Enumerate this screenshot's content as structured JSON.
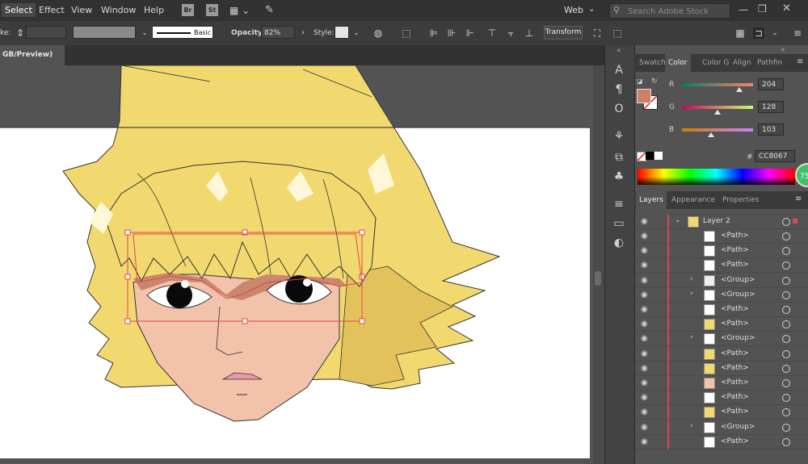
{
  "menu": {
    "items": [
      "Select",
      "Effect",
      "View",
      "Window",
      "Help"
    ],
    "workspace": "Web",
    "search_placeholder": "Search Adobe Stock",
    "bridge": "Br",
    "stock": "St"
  },
  "control": {
    "stroke_label": "ke:",
    "brush": "Basic",
    "opacity_label": "Opacity:",
    "opacity_value": "82%",
    "style_label": "Style:",
    "transform_label": "Transform"
  },
  "doc_tab": "GB/Preview)",
  "color_panel": {
    "tabs": [
      "Swatch",
      "Color",
      "Color G",
      "Align",
      "Pathfin"
    ],
    "r_label": "R",
    "r_value": "204",
    "g_label": "G",
    "g_value": "128",
    "b_label": "B",
    "b_value": "103",
    "hex_label": "#",
    "hex_value": "CC8067",
    "fill_color": "#CC8067",
    "badge": "75"
  },
  "layers_panel": {
    "tabs": [
      "Layers",
      "Appearance",
      "Properties"
    ],
    "layer_name": "Layer 2",
    "rows": [
      {
        "name": "<Path>",
        "caret": ""
      },
      {
        "name": "<Path>",
        "caret": ""
      },
      {
        "name": "<Path>",
        "caret": ""
      },
      {
        "name": "<Group>",
        "caret": "›"
      },
      {
        "name": "<Group>",
        "caret": "›"
      },
      {
        "name": "<Path>",
        "caret": ""
      },
      {
        "name": "<Path>",
        "caret": ""
      },
      {
        "name": "<Group>",
        "caret": "›"
      },
      {
        "name": "<Path>",
        "caret": ""
      },
      {
        "name": "<Path>",
        "caret": ""
      },
      {
        "name": "<Path>",
        "caret": ""
      },
      {
        "name": "<Path>",
        "caret": ""
      },
      {
        "name": "<Path>",
        "caret": ""
      },
      {
        "name": "<Group>",
        "caret": "›"
      },
      {
        "name": "<Path>",
        "caret": ""
      }
    ]
  }
}
